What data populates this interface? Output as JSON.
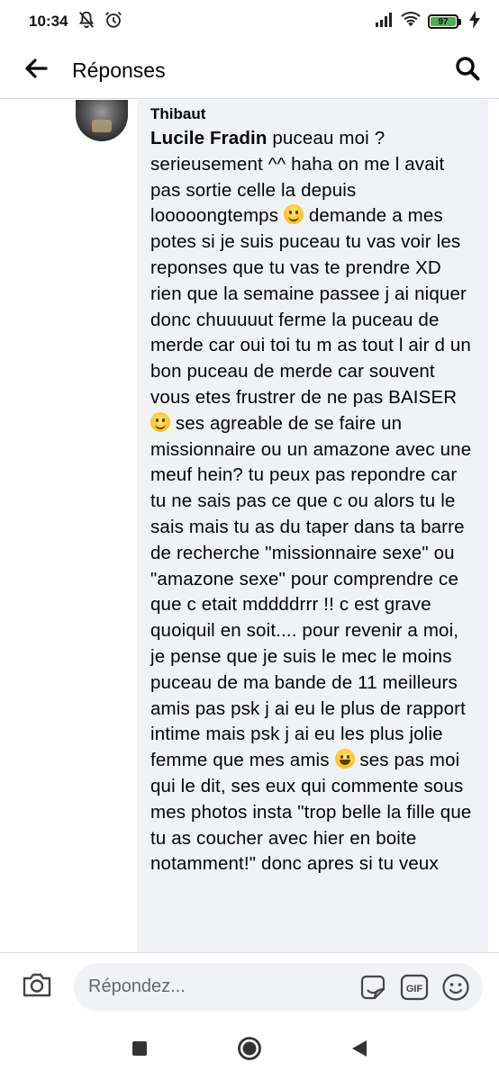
{
  "status_bar": {
    "time": "10:34",
    "battery_level": "97"
  },
  "header": {
    "title": "Réponses"
  },
  "comment": {
    "author": "Thibaut",
    "mention": "Lucile Fradin",
    "segments": [
      " puceau moi ? serieusement ^^ haha on me l avait pas sortie celle la depuis looooongtemps ",
      " demande a mes potes si je suis puceau tu vas voir les reponses que tu vas te prendre XD rien que la semaine passee j ai niquer donc chuuuuut ferme la puceau de merde car oui toi tu m as tout l air d un bon puceau de merde car souvent vous etes frustrer de ne pas BAISER ",
      " ses agreable de se faire un missionnaire ou un amazone avec une meuf hein? tu peux pas repondre car tu ne sais pas ce que c ou alors tu le sais mais tu as du taper dans ta barre de recherche \"missionnaire sexe\" ou \"amazone sexe\" pour comprendre ce que c etait mddddrrr !! c est grave quoiquil en soit.... pour revenir a moi, je pense que je suis le mec le moins puceau de ma bande de 11 meilleurs amis pas psk j ai eu le plus de rapport intime mais psk j ai eu les plus jolie femme que mes amis ",
      " ses pas moi qui le dit, ses eux qui commente sous mes photos insta \"trop belle la fille que tu as coucher avec hier en boite notamment!\" donc apres si tu veux"
    ]
  },
  "composer": {
    "placeholder": "Répondez..."
  },
  "colors": {
    "bubble": "#f0f2f5",
    "text": "#050505",
    "placeholder": "#65676b",
    "battery": "#4caf50"
  }
}
